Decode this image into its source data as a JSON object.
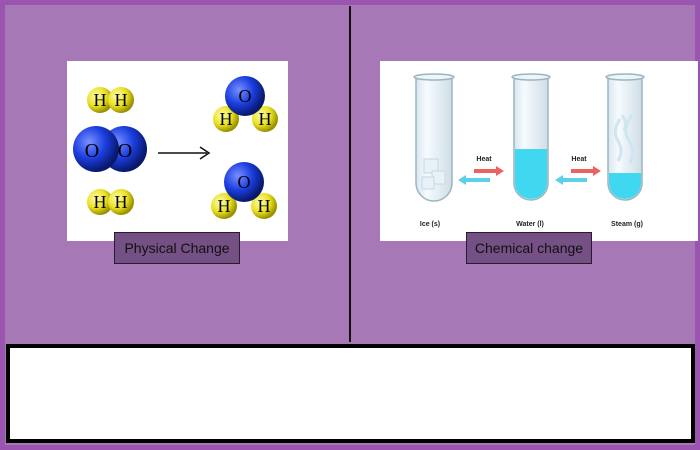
{
  "left_card": {
    "caption": "Physical Change",
    "atoms": {
      "hydrogen": "H",
      "oxygen": "O"
    },
    "colors": {
      "hydrogen": "#e8e020",
      "oxygen": "#1a3ee0"
    }
  },
  "right_card": {
    "caption": "Chemical change",
    "arrow_label_1": "Heat",
    "arrow_label_2": "Heat",
    "tube_labels": [
      "Ice (s)",
      "Water (l)",
      "Steam (g)"
    ],
    "colors": {
      "heat_arrow": "#f06060",
      "cool_arrow": "#5cd0e8",
      "water": "#40d8f0"
    }
  },
  "answer_box": {
    "text": ""
  }
}
